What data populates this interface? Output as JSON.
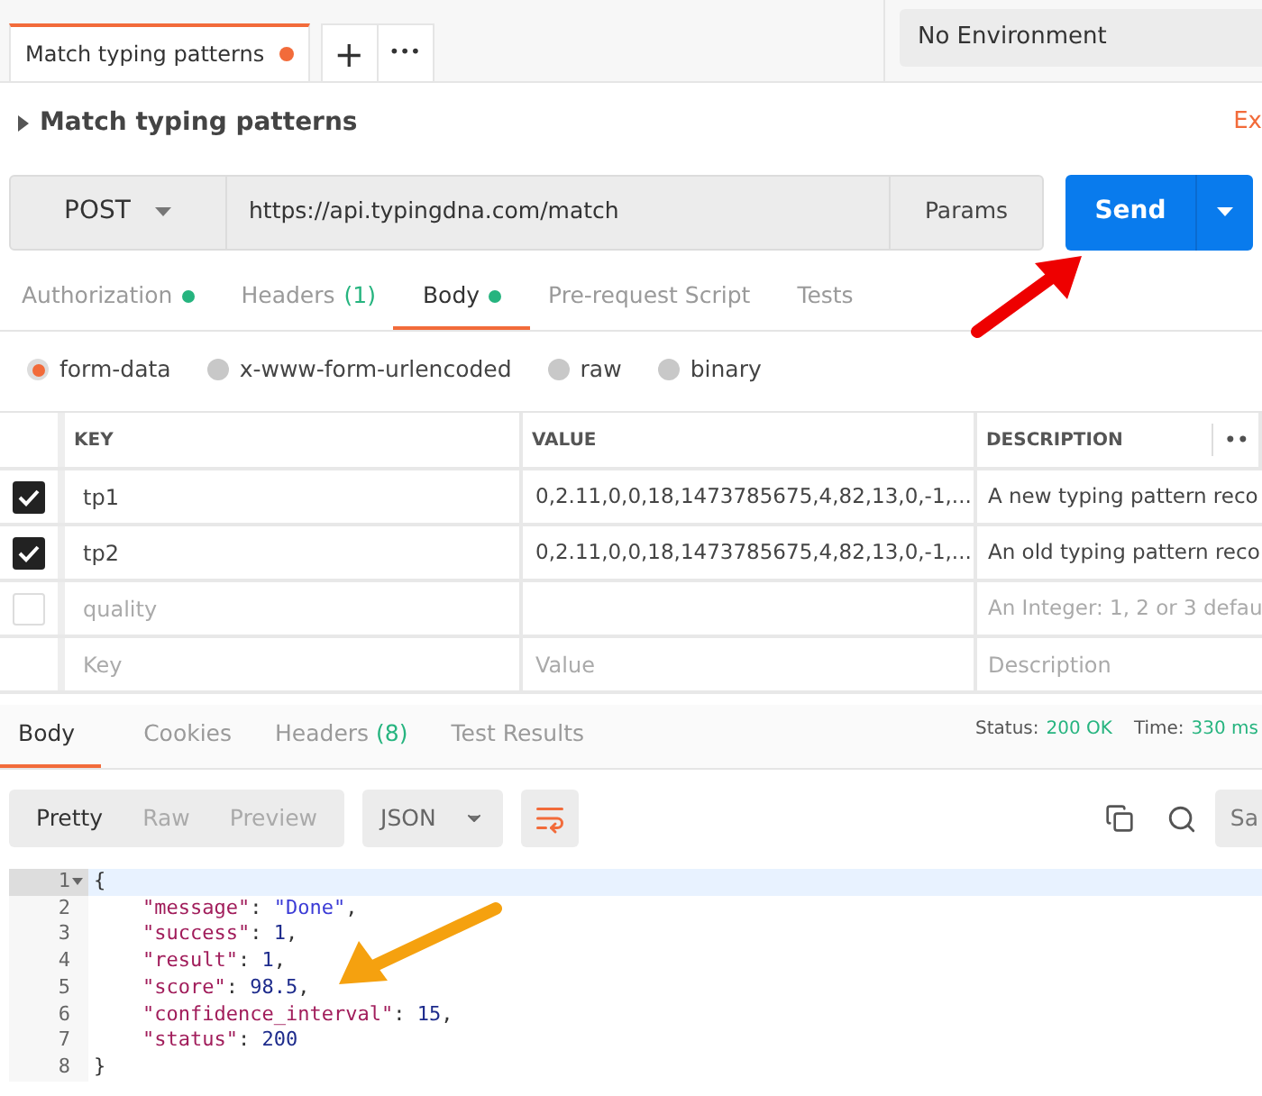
{
  "tabs": [
    {
      "label": "Match typing patterns",
      "selected": true,
      "unsaved": true
    }
  ],
  "tab_actions": {
    "add": "+",
    "more": "•••"
  },
  "environment": {
    "value": "No Environment"
  },
  "request": {
    "name": "Match typing patterns",
    "link": "Ex",
    "method": "POST",
    "url": "https://api.typingdna.com/match",
    "params": "Params",
    "send": "Send"
  },
  "request_tabs": [
    {
      "label": "Authorization",
      "dot": true,
      "selected": false
    },
    {
      "label": "Headers",
      "count": "(1)",
      "dot": false,
      "selected": false
    },
    {
      "label": "Body",
      "dot": true,
      "selected": true
    },
    {
      "label": "Pre-request Script",
      "dot": false,
      "selected": false
    },
    {
      "label": "Tests",
      "dot": false,
      "selected": false
    }
  ],
  "body_types": [
    {
      "label": "form-data",
      "selected": true
    },
    {
      "label": "x-www-form-urlencoded",
      "selected": false
    },
    {
      "label": "raw",
      "selected": false
    },
    {
      "label": "binary",
      "selected": false
    }
  ],
  "table": {
    "columns": [
      "KEY",
      "VALUE",
      "DESCRIPTION"
    ],
    "more": "••",
    "rows": [
      {
        "checked": true,
        "key": "tp1",
        "value": "0,2.11,0,0,18,1473785675,4,82,13,0,-1,...",
        "description": "A new typing pattern reco"
      },
      {
        "checked": true,
        "key": "tp2",
        "value": "0,2.11,0,0,18,1473785675,4,82,13,0,-1,...",
        "description": "An old typing pattern reco"
      },
      {
        "checked": false,
        "key": "quality",
        "value": "",
        "description": "An Integer: 1, 2 or 3 defau"
      }
    ],
    "new_row": {
      "key_placeholder": "Key",
      "value_placeholder": "Value",
      "description_placeholder": "Description"
    }
  },
  "response_tabs": [
    {
      "label": "Body",
      "selected": true
    },
    {
      "label": "Cookies",
      "selected": false
    },
    {
      "label": "Headers",
      "count": "(8)",
      "selected": false
    },
    {
      "label": "Test Results",
      "selected": false
    }
  ],
  "status": {
    "status_label": "Status:",
    "status_value": "200 OK",
    "time_label": "Time:",
    "time_value": "330 ms"
  },
  "view_modes": [
    {
      "label": "Pretty",
      "selected": true
    },
    {
      "label": "Raw",
      "selected": false
    },
    {
      "label": "Preview",
      "selected": false
    }
  ],
  "format": "JSON",
  "save_cut": "Sa",
  "code_lines": [
    {
      "number": "1",
      "fold": true,
      "indented": false,
      "tokens": [
        {
          "kind": "punct",
          "text": "{"
        }
      ]
    },
    {
      "number": "2",
      "fold": false,
      "indented": true,
      "tokens": [
        {
          "kind": "key",
          "text": "\"message\""
        },
        {
          "kind": "punct",
          "text": ": "
        },
        {
          "kind": "string",
          "text": "\"Done\""
        },
        {
          "kind": "punct",
          "text": ","
        }
      ]
    },
    {
      "number": "3",
      "fold": false,
      "indented": true,
      "tokens": [
        {
          "kind": "key",
          "text": "\"success\""
        },
        {
          "kind": "punct",
          "text": ": "
        },
        {
          "kind": "number",
          "text": "1"
        },
        {
          "kind": "punct",
          "text": ","
        }
      ]
    },
    {
      "number": "4",
      "fold": false,
      "indented": true,
      "tokens": [
        {
          "kind": "key",
          "text": "\"result\""
        },
        {
          "kind": "punct",
          "text": ": "
        },
        {
          "kind": "number",
          "text": "1"
        },
        {
          "kind": "punct",
          "text": ","
        }
      ]
    },
    {
      "number": "5",
      "fold": false,
      "indented": true,
      "tokens": [
        {
          "kind": "key",
          "text": "\"score\""
        },
        {
          "kind": "punct",
          "text": ": "
        },
        {
          "kind": "number",
          "text": "98.5"
        },
        {
          "kind": "punct",
          "text": ","
        }
      ]
    },
    {
      "number": "6",
      "fold": false,
      "indented": true,
      "tokens": [
        {
          "kind": "key",
          "text": "\"confidence_interval\""
        },
        {
          "kind": "punct",
          "text": ": "
        },
        {
          "kind": "number",
          "text": "15"
        },
        {
          "kind": "punct",
          "text": ","
        }
      ]
    },
    {
      "number": "7",
      "fold": false,
      "indented": true,
      "tokens": [
        {
          "kind": "key",
          "text": "\"status\""
        },
        {
          "kind": "punct",
          "text": ": "
        },
        {
          "kind": "number",
          "text": "200"
        }
      ]
    },
    {
      "number": "8",
      "fold": false,
      "indented": false,
      "tokens": [
        {
          "kind": "punct",
          "text": "}"
        }
      ]
    }
  ]
}
